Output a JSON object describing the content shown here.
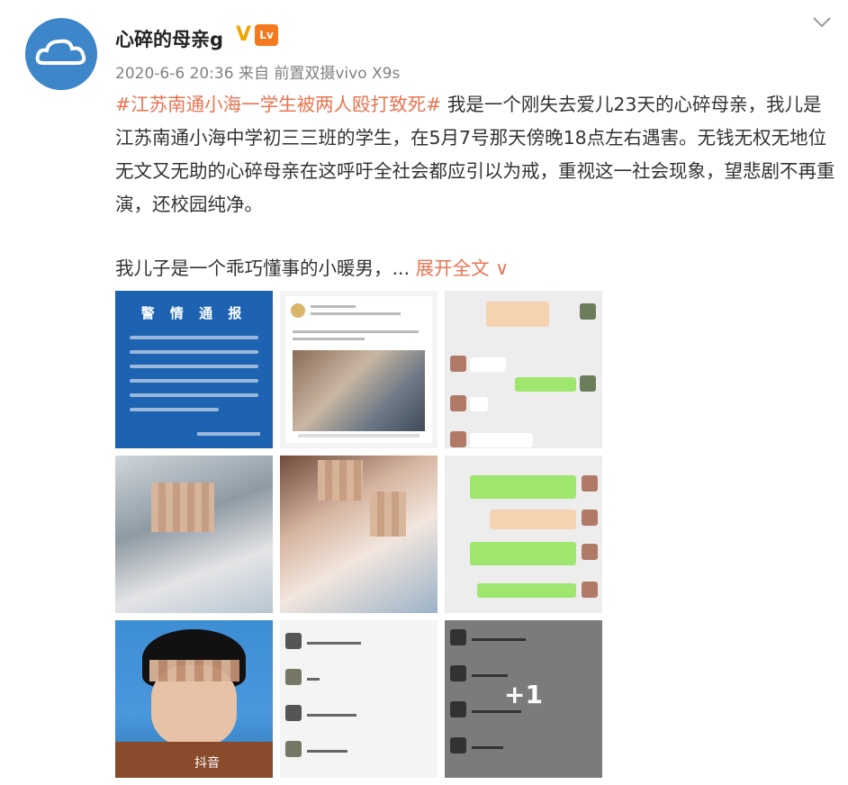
{
  "post": {
    "username": "心碎的母亲g",
    "verified_badge": "V",
    "level_badge": "Lv",
    "date": "2020-6-6 20:36",
    "source": "来自 前置双摄vivo X9s",
    "topic": "#江苏南通小海一学生被两人殴打致死#",
    "body": " 我是一个刚失去爱儿23天的心碎母亲，我儿是江苏南通小海中学初三三班的学生，在5月7号那天傍晚18点左右遇害。无钱无权无地位无文又无助的心碎母亲在这呼吁全社会都应引以为戒，重视这一社会现象，望悲剧不再重演，还校园纯净。",
    "second_paragraph": "我儿子是一个乖巧懂事的小暖男，...",
    "expand_label": "展开全文 ∨",
    "more_images": "+1",
    "notice_title": "警 情 通 报",
    "watermark": "抖音"
  },
  "colors": {
    "topic": "#eb7350",
    "avatar_bg": "#3c86c9",
    "verified": "#f0a500",
    "police_bg": "#1d63b1"
  },
  "icons": {
    "more": "chevron-down-icon"
  }
}
